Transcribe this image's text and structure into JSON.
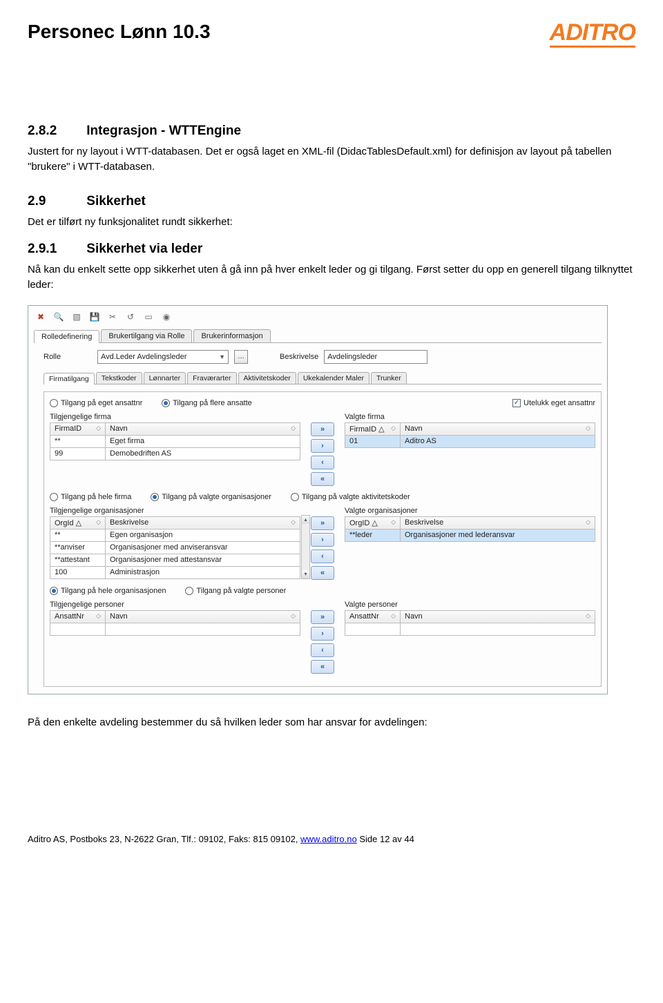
{
  "header": {
    "title": "Personec Lønn 10.3",
    "logo_text": "ADITRO"
  },
  "sections": {
    "s282": {
      "num": "2.8.2",
      "title": "Integrasjon - WTTEngine",
      "body": "Justert for ny layout i WTT-databasen. Det er også laget en XML-fil (DidacTablesDefault.xml) for definisjon av layout på tabellen \"brukere\" i WTT-databasen."
    },
    "s29": {
      "num": "2.9",
      "title": "Sikkerhet",
      "intro": "Det er tilført ny funksjonalitet rundt sikkerhet:"
    },
    "s291": {
      "num": "2.9.1",
      "title": "Sikkerhet via leder",
      "body": "Nå kan du enkelt sette opp sikkerhet uten å gå inn på hver enkelt leder og gi tilgang. Først setter du opp en generell tilgang tilknyttet leder:"
    },
    "after_text": "På den enkelte avdeling bestemmer du så hvilken leder som har ansvar for avdelingen:"
  },
  "screenshot": {
    "main_tabs": [
      "Rolledefinering",
      "Brukertilgang via Rolle",
      "Brukerinformasjon"
    ],
    "role_label": "Rolle",
    "role_value": "Avd.Leder Avdelingsleder",
    "desc_label": "Beskrivelse",
    "desc_value": "Avdelingsleder",
    "inner_tabs": [
      "Firmatilgang",
      "Tekstkoder",
      "Lønnarter",
      "Fraværarter",
      "Aktivitetskoder",
      "Ukekalender Maler",
      "Trunker"
    ],
    "block_firma": {
      "radios": [
        "Tilgang på eget ansattnr",
        "Tilgang på flere ansatte"
      ],
      "radio_selected": 1,
      "checkbox": "Utelukk eget ansattnr",
      "left_label": "Tilgjengelige firma",
      "right_label": "Valgte firma",
      "left_cols": [
        "FirmaID",
        "Navn"
      ],
      "left_rows": [
        {
          "id": "**",
          "name": "Eget firma"
        },
        {
          "id": "99",
          "name": "Demobedriften AS"
        }
      ],
      "right_cols": [
        "FirmaID",
        "Navn"
      ],
      "right_rows": [
        {
          "id": "01",
          "name": "Aditro AS"
        }
      ]
    },
    "block_org": {
      "radios": [
        "Tilgang på hele firma",
        "Tilgang på valgte organisasjoner",
        "Tilgang på valgte aktivitetskoder"
      ],
      "radio_selected": 1,
      "left_label": "Tilgjengelige organisasjoner",
      "right_label": "Valgte organisasjoner",
      "left_cols": [
        "OrgId",
        "Beskrivelse"
      ],
      "left_rows": [
        {
          "id": "**",
          "name": "Egen organisasjon"
        },
        {
          "id": "**anviser",
          "name": "Organisasjoner med anviseransvar"
        },
        {
          "id": "**attestant",
          "name": "Organisasjoner med attestansvar"
        },
        {
          "id": "100",
          "name": "Administrasjon"
        }
      ],
      "right_cols": [
        "OrgID",
        "Beskrivelse"
      ],
      "right_rows": [
        {
          "id": "**leder",
          "name": "Organisasjoner med lederansvar"
        }
      ]
    },
    "block_pers": {
      "radios": [
        "Tilgang på hele organisasjonen",
        "Tilgang på valgte personer"
      ],
      "radio_selected": 0,
      "left_label": "Tilgjengelige personer",
      "right_label": "Valgte personer",
      "left_cols": [
        "AnsattNr",
        "Navn"
      ],
      "right_cols": [
        "AnsattNr",
        "Navn"
      ]
    },
    "arrows": {
      "add_all": "»",
      "add_one": "›",
      "rem_one": "‹",
      "rem_all": "«"
    }
  },
  "footer": {
    "text_before": "Aditro AS, Postboks 23, N-2622 Gran, Tlf.: 09102, Faks: 815 09102, ",
    "link_text": "www.aditro.no",
    "text_after": " Side 12 av 44"
  }
}
